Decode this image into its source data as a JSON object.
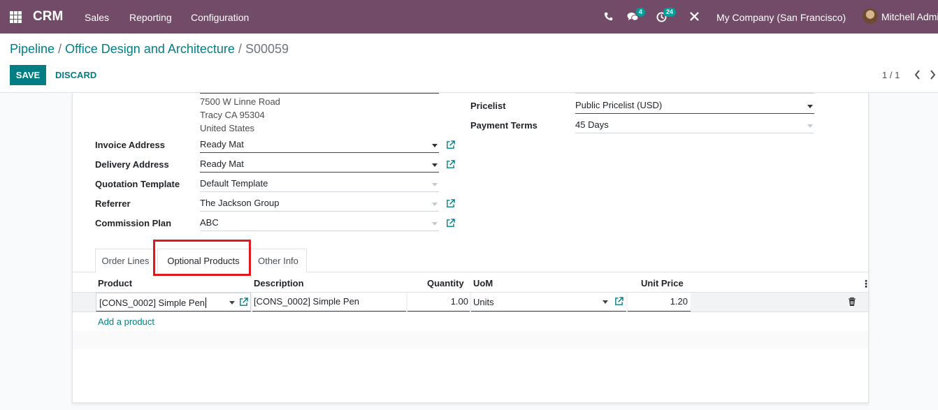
{
  "navbar": {
    "brand": "CRM",
    "menus": [
      "Sales",
      "Reporting",
      "Configuration"
    ],
    "messages_badge": "4",
    "activities_badge": "24",
    "company": "My Company (San Francisco)",
    "user": "Mitchell Admin"
  },
  "breadcrumb": {
    "root": "Pipeline",
    "parent": "Office Design and Architecture",
    "current": "S00059",
    "separator": "/"
  },
  "actions": {
    "save": "SAVE",
    "discard": "DISCARD"
  },
  "pager": {
    "value": "1 / 1"
  },
  "address": [
    "7500 W Linne Road",
    "Tracy CA 95304",
    "United States"
  ],
  "fields": {
    "invoice_address": {
      "label": "Invoice Address",
      "value": "Ready Mat"
    },
    "delivery_address": {
      "label": "Delivery Address",
      "value": "Ready Mat"
    },
    "quotation_template": {
      "label": "Quotation Template",
      "value": "Default Template"
    },
    "referrer": {
      "label": "Referrer",
      "value": "The Jackson Group"
    },
    "commission_plan": {
      "label": "Commission Plan",
      "value": "ABC"
    },
    "pricelist": {
      "label": "Pricelist",
      "value": "Public Pricelist (USD)"
    },
    "payment_terms": {
      "label": "Payment Terms",
      "value": "45 Days"
    }
  },
  "tabs": [
    "Order Lines",
    "Optional Products",
    "Other Info"
  ],
  "table": {
    "headers": {
      "product": "Product",
      "description": "Description",
      "quantity": "Quantity",
      "uom": "UoM",
      "unit_price": "Unit Price"
    },
    "row": {
      "product": "[CONS_0002] Simple Pen",
      "description": "[CONS_0002] Simple Pen",
      "quantity": "1.00",
      "uom": "Units",
      "unit_price": "1.20"
    },
    "add_product": "Add a product"
  },
  "colors": {
    "navbar": "#714b67",
    "primary": "#017e84",
    "highlight": "#e0191f"
  }
}
